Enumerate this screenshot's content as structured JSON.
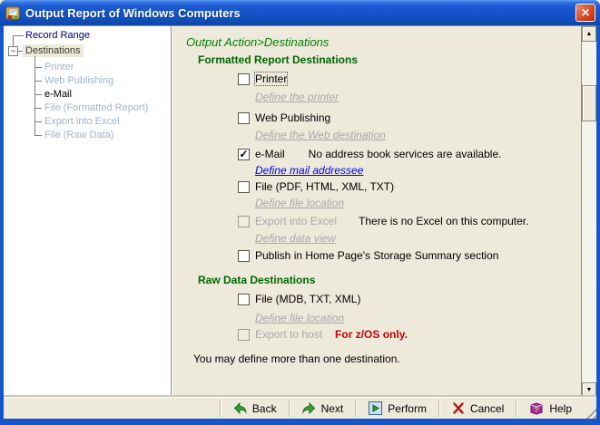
{
  "window": {
    "title": "Output Report of Windows Computers"
  },
  "icons": {
    "close_glyph": "✕",
    "tree_collapse_glyph": "−",
    "scroll_up_glyph": "▲",
    "scroll_down_glyph": "▼",
    "help_qmark_glyph": "?"
  },
  "tree": {
    "items": [
      {
        "label": "Record Range"
      },
      {
        "label": "Destinations"
      },
      {
        "label": "Printer"
      },
      {
        "label": "Web Publishing"
      },
      {
        "label": "e-Mail"
      },
      {
        "label": "File (Formatted Report)"
      },
      {
        "label": "Export into Excel"
      },
      {
        "label": "File (Raw Data)"
      }
    ]
  },
  "content": {
    "breadcrumb": "Output Action>Destinations",
    "formatted_header": "Formatted Report Destinations",
    "raw_header": "Raw Data Destinations",
    "printer": {
      "label": "Printer",
      "link": "Define the printer"
    },
    "web": {
      "label": "Web Publishing",
      "link": "Define the Web destination"
    },
    "email": {
      "label": "e-Mail",
      "checked": "✓",
      "note": "No address book services are available.",
      "link": "Define mail addressee"
    },
    "file_formatted": {
      "label": "File (PDF, HTML, XML, TXT)",
      "link": "Define file location"
    },
    "excel": {
      "label": "Export into Excel",
      "note": "There is no Excel on this computer.",
      "link": "Define data view"
    },
    "publish": {
      "label": "Publish in Home Page's Storage Summary section"
    },
    "file_raw": {
      "label": "File (MDB, TXT, XML)",
      "link": "Define file location"
    },
    "host": {
      "label": "Export to host",
      "note": "For z/OS only."
    },
    "footer": "You may define more than one destination."
  },
  "toolbar": {
    "back": "Back",
    "next": "Next",
    "perform": "Perform",
    "cancel": "Cancel",
    "help": "Help"
  },
  "colors": {
    "breadcrumb_green": "#008000",
    "header_green": "#006600",
    "link_blue": "#0000EE",
    "link_gray": "#A8A8A8",
    "warn_red": "#CC0000",
    "tree_navy": "#000080",
    "tree_child_blue": "#9FB4D2",
    "titlebar_blue": "#1556CB"
  }
}
